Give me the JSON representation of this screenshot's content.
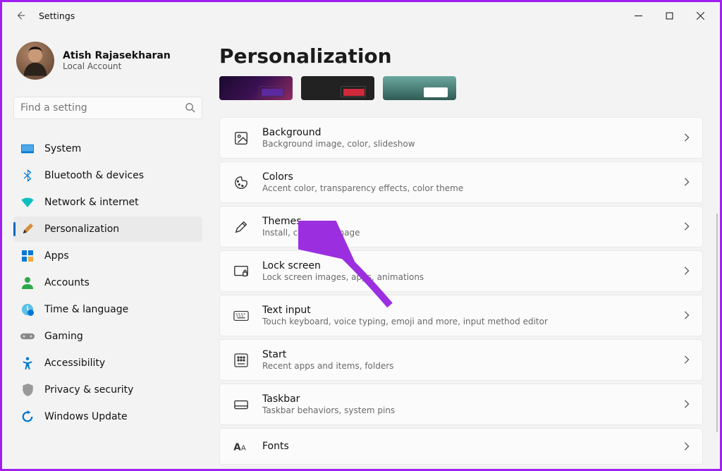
{
  "app_title": "Settings",
  "profile": {
    "name": "Atish Rajasekharan",
    "sub": "Local Account"
  },
  "search": {
    "placeholder": "Find a setting"
  },
  "nav": {
    "items": [
      {
        "label": "System",
        "icon": "system",
        "selected": false
      },
      {
        "label": "Bluetooth & devices",
        "icon": "bluetooth",
        "selected": false
      },
      {
        "label": "Network & internet",
        "icon": "network",
        "selected": false
      },
      {
        "label": "Personalization",
        "icon": "personalization",
        "selected": true
      },
      {
        "label": "Apps",
        "icon": "apps",
        "selected": false
      },
      {
        "label": "Accounts",
        "icon": "accounts",
        "selected": false
      },
      {
        "label": "Time & language",
        "icon": "time",
        "selected": false
      },
      {
        "label": "Gaming",
        "icon": "gaming",
        "selected": false
      },
      {
        "label": "Accessibility",
        "icon": "accessibility",
        "selected": false
      },
      {
        "label": "Privacy & security",
        "icon": "privacy",
        "selected": false
      },
      {
        "label": "Windows Update",
        "icon": "update",
        "selected": false
      }
    ]
  },
  "page": {
    "title": "Personalization"
  },
  "cards": [
    {
      "title": "Background",
      "desc": "Background image, color, slideshow",
      "icon": "background"
    },
    {
      "title": "Colors",
      "desc": "Accent color, transparency effects, color theme",
      "icon": "colors"
    },
    {
      "title": "Themes",
      "desc": "Install, create, manage",
      "icon": "themes"
    },
    {
      "title": "Lock screen",
      "desc": "Lock screen images, apps, animations",
      "icon": "lockscreen"
    },
    {
      "title": "Text input",
      "desc": "Touch keyboard, voice typing, emoji and more, input method editor",
      "icon": "textinput"
    },
    {
      "title": "Start",
      "desc": "Recent apps and items, folders",
      "icon": "start"
    },
    {
      "title": "Taskbar",
      "desc": "Taskbar behaviors, system pins",
      "icon": "taskbar"
    },
    {
      "title": "Fonts",
      "desc": "",
      "icon": "fonts"
    }
  ]
}
